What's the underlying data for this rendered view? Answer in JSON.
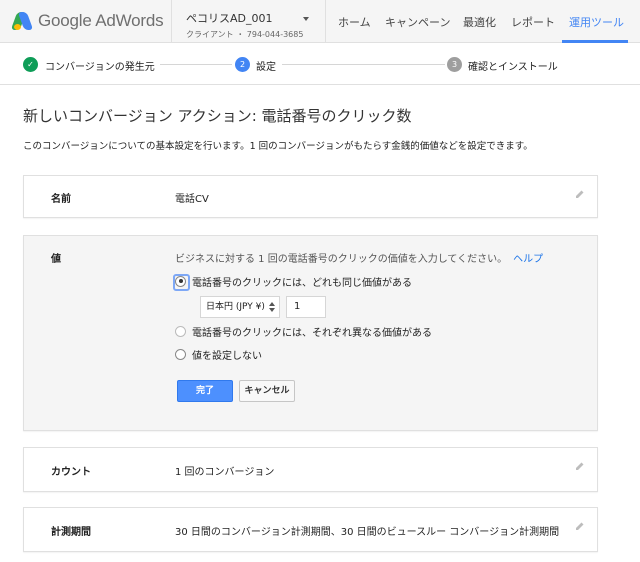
{
  "brand": {
    "name": "Google AdWords"
  },
  "account": {
    "name": "ペコリスAD_001",
    "sub": "クライアント ・ 794-044-3685"
  },
  "nav": {
    "items": [
      {
        "label": "ホーム"
      },
      {
        "label": "キャンペーン"
      },
      {
        "label": "最適化"
      },
      {
        "label": "レポート"
      },
      {
        "label": "運用ツール",
        "active": true
      }
    ]
  },
  "stepper": {
    "steps": [
      {
        "marker": "✓",
        "label": "コンバージョンの発生元",
        "state": "done"
      },
      {
        "marker": "2",
        "label": "設定",
        "state": "current"
      },
      {
        "marker": "3",
        "label": "確認とインストール",
        "state": "pending"
      }
    ]
  },
  "page": {
    "title": "新しいコンバージョン アクション: 電話番号のクリック数",
    "description": "このコンバージョンについての基本設定を行います。1 回のコンバージョンがもたらす金銭的価値などを設定できます。"
  },
  "settings": {
    "name": {
      "key": "名前",
      "value": "電話CV"
    },
    "value": {
      "key": "値",
      "help_text": "ビジネスに対する 1 回の電話番号のクリックの価値を入力してください。",
      "help_link": "ヘルプ",
      "options": [
        {
          "label": "電話番号のクリックには、どれも同じ価値がある",
          "checked": true
        },
        {
          "label": "電話番号のクリックには、それぞれ異なる価値がある",
          "checked": false
        },
        {
          "label": "値を設定しない",
          "checked": false
        }
      ],
      "currency": "日本円 (JPY ¥)",
      "amount": "1",
      "done_label": "完了",
      "cancel_label": "キャンセル"
    },
    "count": {
      "key": "カウント",
      "value": "1 回のコンバージョン"
    },
    "window": {
      "key": "計測期間",
      "value": "30 日間のコンバージョン計測期間、30 日間のビュースルー コンバージョン計測期間"
    }
  },
  "colors": {
    "accent": "#4285f4",
    "primary_button": "#4d90fe",
    "done_check": "#0f9d58",
    "pending_step": "#9e9e9e"
  },
  "icons": {
    "edit": "pencil-icon",
    "done": "check-icon",
    "dropdown": "chevron-down-icon"
  }
}
